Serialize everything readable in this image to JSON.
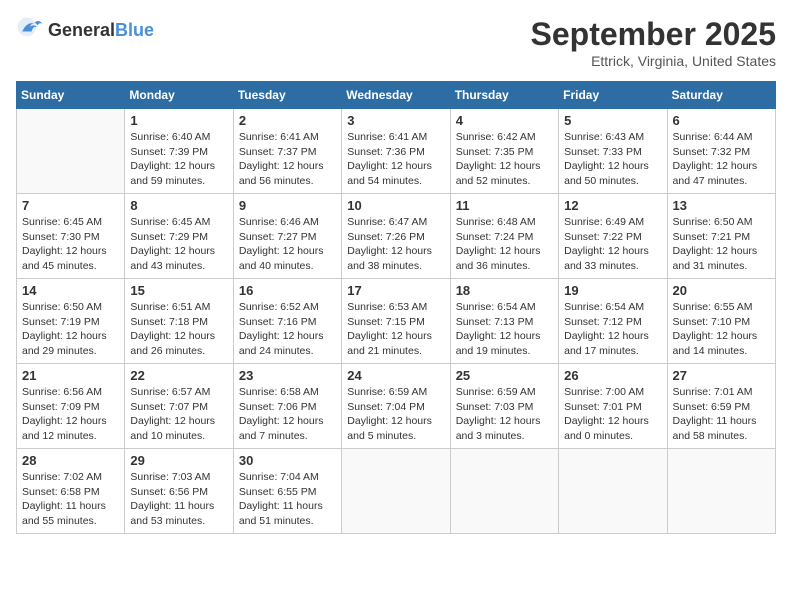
{
  "header": {
    "logo_general": "General",
    "logo_blue": "Blue",
    "month": "September 2025",
    "location": "Ettrick, Virginia, United States"
  },
  "days_of_week": [
    "Sunday",
    "Monday",
    "Tuesday",
    "Wednesday",
    "Thursday",
    "Friday",
    "Saturday"
  ],
  "weeks": [
    [
      {
        "day": "",
        "sunrise": "",
        "sunset": "",
        "daylight": ""
      },
      {
        "day": "1",
        "sunrise": "Sunrise: 6:40 AM",
        "sunset": "Sunset: 7:39 PM",
        "daylight": "Daylight: 12 hours and 59 minutes."
      },
      {
        "day": "2",
        "sunrise": "Sunrise: 6:41 AM",
        "sunset": "Sunset: 7:37 PM",
        "daylight": "Daylight: 12 hours and 56 minutes."
      },
      {
        "day": "3",
        "sunrise": "Sunrise: 6:41 AM",
        "sunset": "Sunset: 7:36 PM",
        "daylight": "Daylight: 12 hours and 54 minutes."
      },
      {
        "day": "4",
        "sunrise": "Sunrise: 6:42 AM",
        "sunset": "Sunset: 7:35 PM",
        "daylight": "Daylight: 12 hours and 52 minutes."
      },
      {
        "day": "5",
        "sunrise": "Sunrise: 6:43 AM",
        "sunset": "Sunset: 7:33 PM",
        "daylight": "Daylight: 12 hours and 50 minutes."
      },
      {
        "day": "6",
        "sunrise": "Sunrise: 6:44 AM",
        "sunset": "Sunset: 7:32 PM",
        "daylight": "Daylight: 12 hours and 47 minutes."
      }
    ],
    [
      {
        "day": "7",
        "sunrise": "Sunrise: 6:45 AM",
        "sunset": "Sunset: 7:30 PM",
        "daylight": "Daylight: 12 hours and 45 minutes."
      },
      {
        "day": "8",
        "sunrise": "Sunrise: 6:45 AM",
        "sunset": "Sunset: 7:29 PM",
        "daylight": "Daylight: 12 hours and 43 minutes."
      },
      {
        "day": "9",
        "sunrise": "Sunrise: 6:46 AM",
        "sunset": "Sunset: 7:27 PM",
        "daylight": "Daylight: 12 hours and 40 minutes."
      },
      {
        "day": "10",
        "sunrise": "Sunrise: 6:47 AM",
        "sunset": "Sunset: 7:26 PM",
        "daylight": "Daylight: 12 hours and 38 minutes."
      },
      {
        "day": "11",
        "sunrise": "Sunrise: 6:48 AM",
        "sunset": "Sunset: 7:24 PM",
        "daylight": "Daylight: 12 hours and 36 minutes."
      },
      {
        "day": "12",
        "sunrise": "Sunrise: 6:49 AM",
        "sunset": "Sunset: 7:22 PM",
        "daylight": "Daylight: 12 hours and 33 minutes."
      },
      {
        "day": "13",
        "sunrise": "Sunrise: 6:50 AM",
        "sunset": "Sunset: 7:21 PM",
        "daylight": "Daylight: 12 hours and 31 minutes."
      }
    ],
    [
      {
        "day": "14",
        "sunrise": "Sunrise: 6:50 AM",
        "sunset": "Sunset: 7:19 PM",
        "daylight": "Daylight: 12 hours and 29 minutes."
      },
      {
        "day": "15",
        "sunrise": "Sunrise: 6:51 AM",
        "sunset": "Sunset: 7:18 PM",
        "daylight": "Daylight: 12 hours and 26 minutes."
      },
      {
        "day": "16",
        "sunrise": "Sunrise: 6:52 AM",
        "sunset": "Sunset: 7:16 PM",
        "daylight": "Daylight: 12 hours and 24 minutes."
      },
      {
        "day": "17",
        "sunrise": "Sunrise: 6:53 AM",
        "sunset": "Sunset: 7:15 PM",
        "daylight": "Daylight: 12 hours and 21 minutes."
      },
      {
        "day": "18",
        "sunrise": "Sunrise: 6:54 AM",
        "sunset": "Sunset: 7:13 PM",
        "daylight": "Daylight: 12 hours and 19 minutes."
      },
      {
        "day": "19",
        "sunrise": "Sunrise: 6:54 AM",
        "sunset": "Sunset: 7:12 PM",
        "daylight": "Daylight: 12 hours and 17 minutes."
      },
      {
        "day": "20",
        "sunrise": "Sunrise: 6:55 AM",
        "sunset": "Sunset: 7:10 PM",
        "daylight": "Daylight: 12 hours and 14 minutes."
      }
    ],
    [
      {
        "day": "21",
        "sunrise": "Sunrise: 6:56 AM",
        "sunset": "Sunset: 7:09 PM",
        "daylight": "Daylight: 12 hours and 12 minutes."
      },
      {
        "day": "22",
        "sunrise": "Sunrise: 6:57 AM",
        "sunset": "Sunset: 7:07 PM",
        "daylight": "Daylight: 12 hours and 10 minutes."
      },
      {
        "day": "23",
        "sunrise": "Sunrise: 6:58 AM",
        "sunset": "Sunset: 7:06 PM",
        "daylight": "Daylight: 12 hours and 7 minutes."
      },
      {
        "day": "24",
        "sunrise": "Sunrise: 6:59 AM",
        "sunset": "Sunset: 7:04 PM",
        "daylight": "Daylight: 12 hours and 5 minutes."
      },
      {
        "day": "25",
        "sunrise": "Sunrise: 6:59 AM",
        "sunset": "Sunset: 7:03 PM",
        "daylight": "Daylight: 12 hours and 3 minutes."
      },
      {
        "day": "26",
        "sunrise": "Sunrise: 7:00 AM",
        "sunset": "Sunset: 7:01 PM",
        "daylight": "Daylight: 12 hours and 0 minutes."
      },
      {
        "day": "27",
        "sunrise": "Sunrise: 7:01 AM",
        "sunset": "Sunset: 6:59 PM",
        "daylight": "Daylight: 11 hours and 58 minutes."
      }
    ],
    [
      {
        "day": "28",
        "sunrise": "Sunrise: 7:02 AM",
        "sunset": "Sunset: 6:58 PM",
        "daylight": "Daylight: 11 hours and 55 minutes."
      },
      {
        "day": "29",
        "sunrise": "Sunrise: 7:03 AM",
        "sunset": "Sunset: 6:56 PM",
        "daylight": "Daylight: 11 hours and 53 minutes."
      },
      {
        "day": "30",
        "sunrise": "Sunrise: 7:04 AM",
        "sunset": "Sunset: 6:55 PM",
        "daylight": "Daylight: 11 hours and 51 minutes."
      },
      {
        "day": "",
        "sunrise": "",
        "sunset": "",
        "daylight": ""
      },
      {
        "day": "",
        "sunrise": "",
        "sunset": "",
        "daylight": ""
      },
      {
        "day": "",
        "sunrise": "",
        "sunset": "",
        "daylight": ""
      },
      {
        "day": "",
        "sunrise": "",
        "sunset": "",
        "daylight": ""
      }
    ]
  ]
}
